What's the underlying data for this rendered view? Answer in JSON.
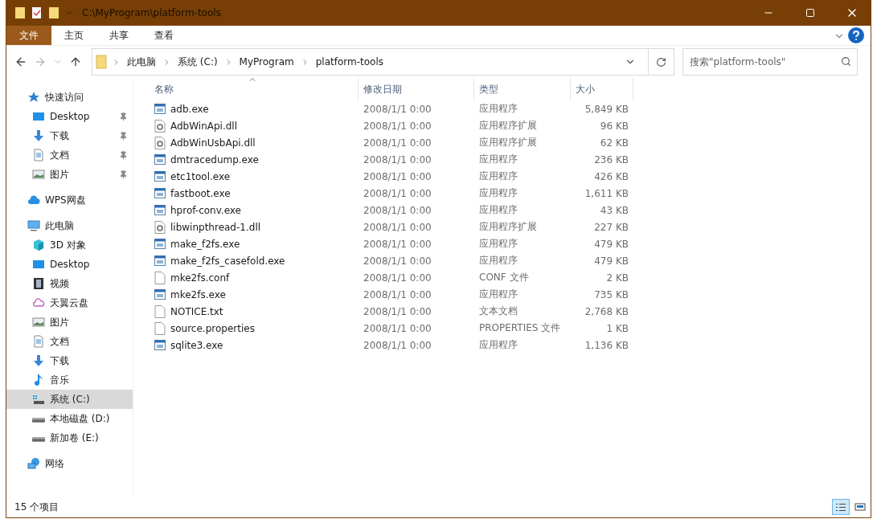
{
  "window": {
    "title": "C:\\MyProgram\\platform-tools"
  },
  "ribbon_tabs": [
    {
      "label": "文件",
      "selected": true
    },
    {
      "label": "主页",
      "selected": false
    },
    {
      "label": "共享",
      "selected": false
    },
    {
      "label": "查看",
      "selected": false
    }
  ],
  "breadcrumb": [
    "此电脑",
    "系统 (C:)",
    "MyProgram",
    "platform-tools"
  ],
  "search": {
    "placeholder": "搜索\"platform-tools\""
  },
  "sidebar": {
    "sections": [
      {
        "label": "快速访问",
        "kind": "star",
        "selected": false,
        "children": [
          {
            "label": "Desktop",
            "kind": "desktop",
            "pinned": true,
            "selected": false
          },
          {
            "label": "下载",
            "kind": "download",
            "pinned": true,
            "selected": false
          },
          {
            "label": "文档",
            "kind": "document",
            "pinned": true,
            "selected": false
          },
          {
            "label": "图片",
            "kind": "picture",
            "pinned": true,
            "selected": false
          }
        ]
      },
      {
        "label": "WPS网盘",
        "kind": "cloud",
        "selected": false
      },
      {
        "label": "此电脑",
        "kind": "computer",
        "selected": false,
        "children": [
          {
            "label": "3D 对象",
            "kind": "cube",
            "pinned": false,
            "selected": false
          },
          {
            "label": "Desktop",
            "kind": "desktop",
            "pinned": false,
            "selected": false
          },
          {
            "label": "视频",
            "kind": "film",
            "pinned": false,
            "selected": false
          },
          {
            "label": "天翼云盘",
            "kind": "cloud2",
            "pinned": false,
            "selected": false
          },
          {
            "label": "图片",
            "kind": "picture",
            "pinned": false,
            "selected": false
          },
          {
            "label": "文档",
            "kind": "document",
            "pinned": false,
            "selected": false
          },
          {
            "label": "下载",
            "kind": "download",
            "pinned": false,
            "selected": false
          },
          {
            "label": "音乐",
            "kind": "music",
            "pinned": false,
            "selected": false
          },
          {
            "label": "系统 (C:)",
            "kind": "sysdrive",
            "pinned": false,
            "selected": true
          },
          {
            "label": "本地磁盘 (D:)",
            "kind": "drive",
            "pinned": false,
            "selected": false
          },
          {
            "label": "新加卷 (E:)",
            "kind": "drive",
            "pinned": false,
            "selected": false
          }
        ]
      },
      {
        "label": "网络",
        "kind": "network",
        "selected": false
      }
    ]
  },
  "table": {
    "columns": [
      "名称",
      "修改日期",
      "类型",
      "大小"
    ],
    "rows": [
      {
        "kind": "exe",
        "name": "adb.exe",
        "date": "2008/1/1 0:00",
        "type": "应用程序",
        "size": "5,849 KB"
      },
      {
        "kind": "dll",
        "name": "AdbWinApi.dll",
        "date": "2008/1/1 0:00",
        "type": "应用程序扩展",
        "size": "96 KB"
      },
      {
        "kind": "dll",
        "name": "AdbWinUsbApi.dll",
        "date": "2008/1/1 0:00",
        "type": "应用程序扩展",
        "size": "62 KB"
      },
      {
        "kind": "exe",
        "name": "dmtracedump.exe",
        "date": "2008/1/1 0:00",
        "type": "应用程序",
        "size": "236 KB"
      },
      {
        "kind": "exe",
        "name": "etc1tool.exe",
        "date": "2008/1/1 0:00",
        "type": "应用程序",
        "size": "426 KB"
      },
      {
        "kind": "exe",
        "name": "fastboot.exe",
        "date": "2008/1/1 0:00",
        "type": "应用程序",
        "size": "1,611 KB"
      },
      {
        "kind": "exe",
        "name": "hprof-conv.exe",
        "date": "2008/1/1 0:00",
        "type": "应用程序",
        "size": "43 KB"
      },
      {
        "kind": "dll",
        "name": "libwinpthread-1.dll",
        "date": "2008/1/1 0:00",
        "type": "应用程序扩展",
        "size": "227 KB"
      },
      {
        "kind": "exe",
        "name": "make_f2fs.exe",
        "date": "2008/1/1 0:00",
        "type": "应用程序",
        "size": "479 KB"
      },
      {
        "kind": "exe",
        "name": "make_f2fs_casefold.exe",
        "date": "2008/1/1 0:00",
        "type": "应用程序",
        "size": "479 KB"
      },
      {
        "kind": "file",
        "name": "mke2fs.conf",
        "date": "2008/1/1 0:00",
        "type": "CONF 文件",
        "size": "2 KB"
      },
      {
        "kind": "exe",
        "name": "mke2fs.exe",
        "date": "2008/1/1 0:00",
        "type": "应用程序",
        "size": "735 KB"
      },
      {
        "kind": "file",
        "name": "NOTICE.txt",
        "date": "2008/1/1 0:00",
        "type": "文本文档",
        "size": "2,768 KB"
      },
      {
        "kind": "file",
        "name": "source.properties",
        "date": "2008/1/1 0:00",
        "type": "PROPERTIES 文件",
        "size": "1 KB"
      },
      {
        "kind": "exe",
        "name": "sqlite3.exe",
        "date": "2008/1/1 0:00",
        "type": "应用程序",
        "size": "1,136 KB"
      }
    ]
  },
  "status_bar": {
    "count": "15 个项目",
    "views": [
      {
        "kind": "details",
        "selected": true
      },
      {
        "kind": "tiles",
        "selected": false
      }
    ]
  }
}
